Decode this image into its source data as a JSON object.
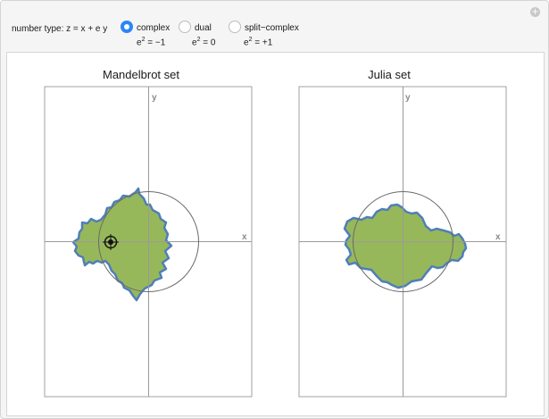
{
  "controls": {
    "label": "number type: z = x + e y",
    "options": [
      {
        "label": "complex",
        "sub_base": "e",
        "sub_exp": "2",
        "sub_rest": " = −1",
        "selected": true
      },
      {
        "label": "dual",
        "sub_base": "e",
        "sub_exp": "2",
        "sub_rest": " = 0",
        "selected": false
      },
      {
        "label": "split−complex",
        "sub_base": "e",
        "sub_exp": "2",
        "sub_rest": " = +1",
        "selected": false
      }
    ]
  },
  "corner_button": "+",
  "plots": {
    "mandelbrot": {
      "title": "Mandelbrot set",
      "xlabel": "x",
      "ylabel": "y"
    },
    "julia": {
      "title": "Julia set",
      "xlabel": "x",
      "ylabel": "y"
    }
  },
  "colors": {
    "fill": "#97b85a",
    "edge": "#4f7fb8",
    "axis": "#9a9a9a",
    "circle": "#6a6a6a",
    "radio_selected": "#2a86f5"
  },
  "icons": {
    "locator": "crosshair-locator-icon"
  }
}
